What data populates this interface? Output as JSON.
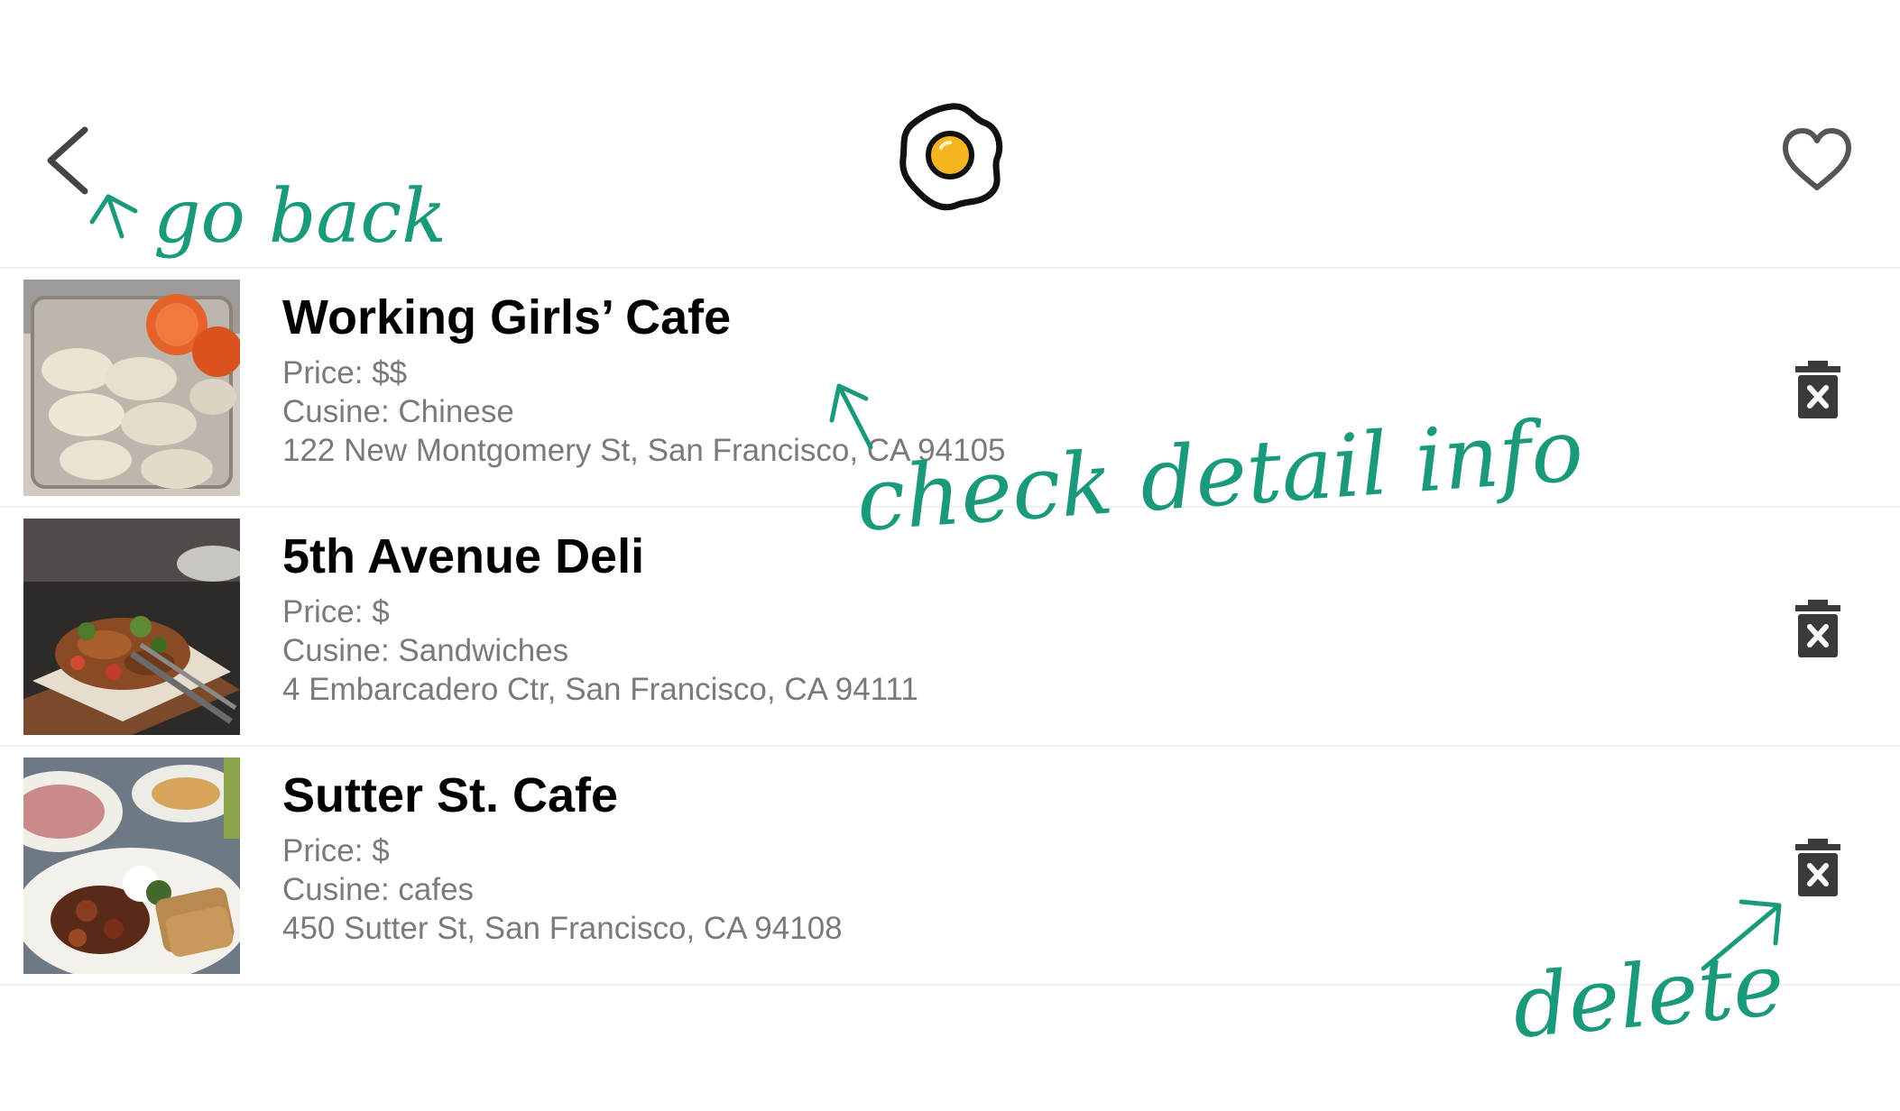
{
  "header": {
    "back_icon": "chevron-left-icon",
    "logo_icon": "fried-egg-logo",
    "favorite_icon": "heart-outline-icon"
  },
  "restaurants": [
    {
      "name": "Working Girls’ Cafe",
      "price": "Price: $$",
      "cuisine": "Cusine: Chinese",
      "address": "122 New Montgomery St, San Francisco, CA 94105",
      "photo": "dumplings-photo"
    },
    {
      "name": "5th Avenue Deli",
      "price": "Price: $",
      "cuisine": "Cusine: Sandwiches",
      "address": "4 Embarcadero Ctr, San Francisco, CA 94111",
      "photo": "salad-platter-photo"
    },
    {
      "name": "Sutter St. Cafe",
      "price": "Price: $",
      "cuisine": "Cusine: cafes",
      "address": "450 Sutter St, San Francisco, CA 94108",
      "photo": "breakfast-plate-photo"
    }
  ],
  "row_actions": {
    "delete_icon": "trash-icon"
  },
  "annotations": {
    "go_back": "go back",
    "check_detail": "check detail info",
    "delete": "delete",
    "ink_color": "#1a9a7a"
  }
}
